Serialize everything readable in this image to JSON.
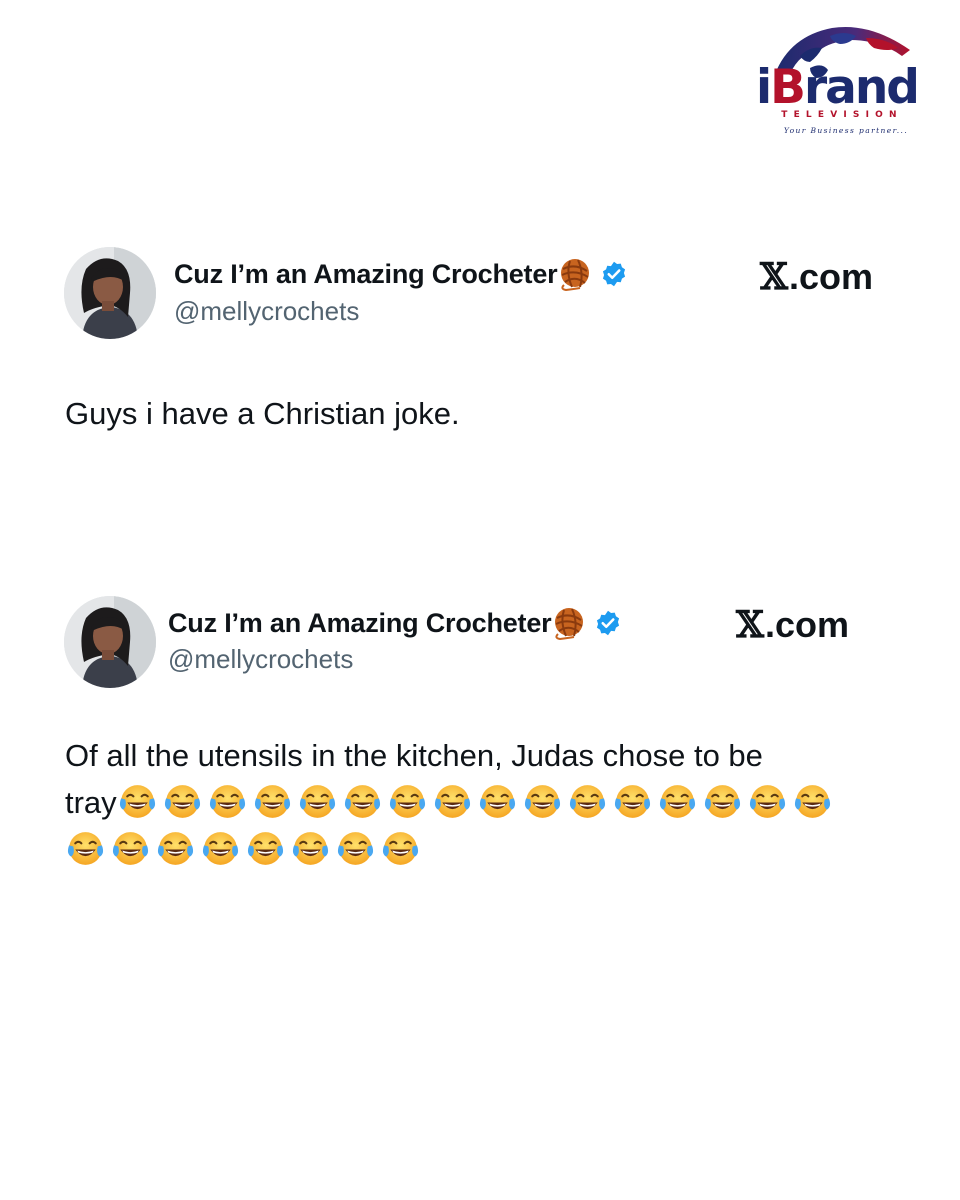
{
  "brand": {
    "name_i": "i",
    "name_b": "B",
    "name_rest": "rand",
    "subtitle": "TELEVISION",
    "tagline": "Your Business partner...",
    "colors": {
      "navy": "#1c2b6e",
      "red": "#b3122b"
    }
  },
  "tweets": [
    {
      "display_name": "Cuz I’m an Amazing Crocheter",
      "handle": "@mellycrochets",
      "source": ".com",
      "source_icon": "x-logo-icon",
      "verified": true,
      "text_line_1": "Guys i have a Christian joke."
    },
    {
      "display_name": "Cuz I’m an Amazing Crocheter",
      "handle": "@mellycrochets",
      "source": ".com",
      "source_icon": "x-logo-icon",
      "verified": true,
      "text_line_1": "Of all the utensils in the kitchen, Judas chose to be",
      "text_line_2": "tray",
      "emoji": "😂",
      "emoji_count_line_2": 16,
      "emoji_count_line_3": 8
    }
  ],
  "colors": {
    "text": "#0f1419",
    "secondary_text": "#536471",
    "verified_blue": "#1d9bf0",
    "yarn_orange": "#d2691e"
  }
}
